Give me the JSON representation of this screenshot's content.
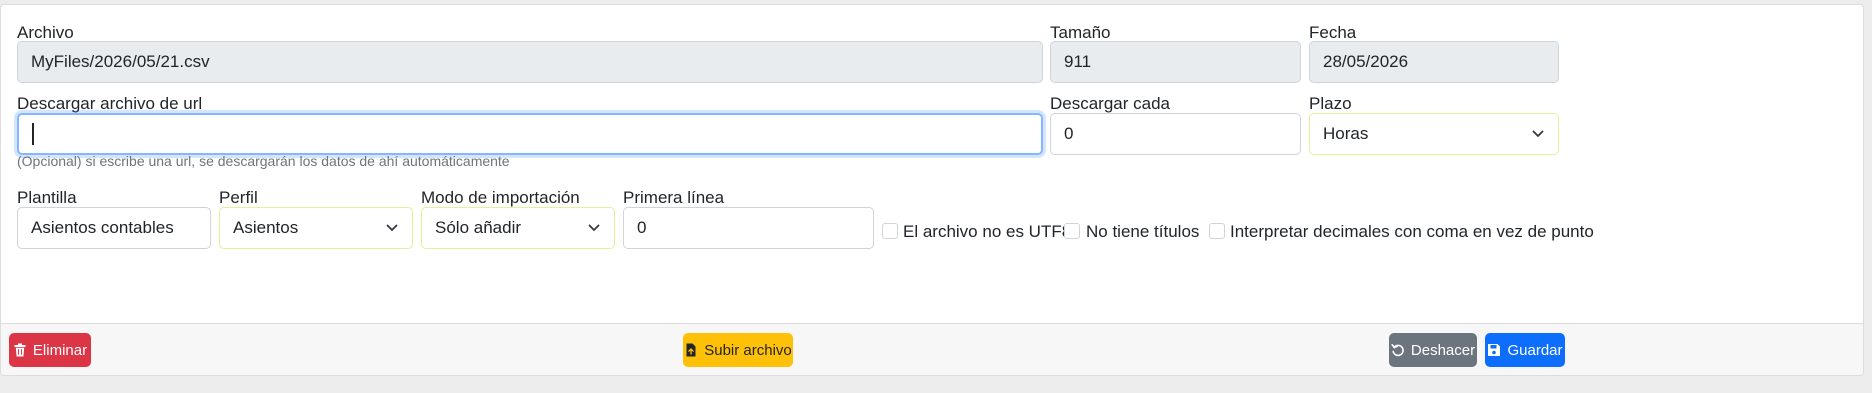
{
  "archivo": {
    "label": "Archivo",
    "value": "MyFiles/2026/05/21.csv"
  },
  "tamano": {
    "label": "Tamaño",
    "value": "911"
  },
  "fecha": {
    "label": "Fecha",
    "value": "28/05/2026"
  },
  "url": {
    "label": "Descargar archivo de url",
    "value": "",
    "help": "(Opcional) si escribe una url, se descargarán los datos de ahí automáticamente"
  },
  "descargar_cada": {
    "label": "Descargar cada",
    "value": "0"
  },
  "plazo": {
    "label": "Plazo",
    "selected": "Horas"
  },
  "plantilla": {
    "label": "Plantilla",
    "value": "Asientos contables"
  },
  "perfil": {
    "label": "Perfil",
    "selected": "Asientos"
  },
  "modo": {
    "label": "Modo de importación",
    "selected": "Sólo añadir"
  },
  "primera_linea": {
    "label": "Primera línea",
    "value": "0"
  },
  "checks": {
    "utf8": {
      "label": "El archivo no es UTF8",
      "checked": false
    },
    "titulos": {
      "label": "No tiene títulos",
      "checked": false
    },
    "decimales": {
      "label": "Interpretar decimales con coma en vez de punto",
      "checked": false
    }
  },
  "buttons": {
    "eliminar": "Eliminar",
    "subir": "Subir archivo",
    "deshacer": "Deshacer",
    "guardar": "Guardar"
  },
  "colors": {
    "danger": "#dc3545",
    "warning": "#ffc107",
    "secondary": "#6c757d",
    "primary": "#0d6efd"
  }
}
